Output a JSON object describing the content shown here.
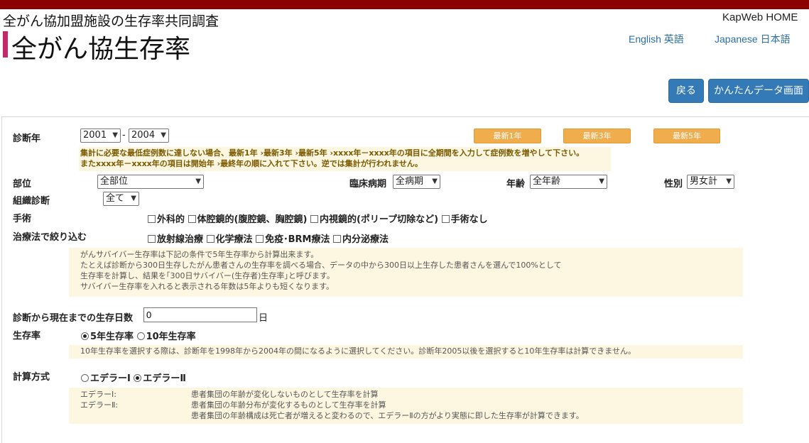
{
  "header": {
    "subtitle": "全がん協加盟施設の生存率共同調査",
    "title": "全がん協生存率",
    "kapweb_link": "KapWeb HOME",
    "lang_en": "English 英語",
    "lang_ja": "Japanese 日本語"
  },
  "toolbar": {
    "back_label": "戻る",
    "simple_label": "かんたんデータ画面"
  },
  "form": {
    "diag_year": {
      "label": "診断年",
      "from": "2001",
      "to": "2004",
      "separator": "-",
      "recent_buttons": [
        "最新1年",
        "最新3年",
        "最新5年"
      ],
      "warning_lines": [
        "集計に必要な最低症例数に達しない場合、最新1年 ›最新3年 ›最新5年 ›xxxx年－xxxx年の項目に全期間を入力して症例数を増やして下さい。",
        "またxxxx年－xxxx年の項目は開始年 ›最終年の順に入れて下さい。逆では集計が行われません。"
      ]
    },
    "site": {
      "label": "部位",
      "value": "全部位"
    },
    "stage": {
      "label": "臨床病期",
      "value": "全病期"
    },
    "age": {
      "label": "年齢",
      "value": "全年齢"
    },
    "sex": {
      "label": "性別",
      "value": "男女計"
    },
    "histology": {
      "label": "組織診断",
      "value": "全て"
    },
    "surgery": {
      "label": "手術",
      "options": [
        "外科的",
        "体腔鏡的(腹腔鏡、胸腔鏡)",
        "内視鏡的(ポリープ切除など)",
        "手術なし"
      ]
    },
    "therapy": {
      "label": "治療法で絞り込む",
      "options": [
        "放射線治療",
        "化学療法",
        "免疫･BRM療法",
        "内分泌療法"
      ]
    },
    "survivor_note": [
      "がんサバイバー生存率は下記の条件で5年生存率から計算出来ます。",
      "たとえば診断から300日生存したがん患者さんの生存率を調べる場合、データの中から300日以上生存した患者さんを選んで100%として",
      "生存率を計算し、結果を｢300日サバイバー(生存者)生存率｣と呼びます。",
      "サバイバー生存率を入れると表示される年数は5年よりも短くなります。"
    ],
    "survival_days": {
      "label": "診断から現在までの生存日数",
      "value": "0",
      "unit": "日"
    },
    "rate": {
      "label": "生存率",
      "option5": "5年生存率",
      "option10": "10年生存率",
      "selected": "5年生存率",
      "note": "10年生存率を選択する際は、診断年を1998年から2004年の間になるように選択してください。診断年2005以後を選択すると10年生存率は計算できません。"
    },
    "method": {
      "label": "計算方式",
      "option1": "エデラーⅠ",
      "option2": "エデラーⅡ",
      "selected": "エデラーⅡ",
      "notes": [
        {
          "term": "エデラーⅠ:",
          "desc": "患者集団の年齢が変化しないものとして生存率を計算"
        },
        {
          "term": "エデラーⅡ:",
          "desc": "患者集団の年齢分布が変化するものとして生存率を計算"
        },
        {
          "term": "",
          "desc": "患者集団の年齢構成は死亡者が増えると変わるので、エデラーⅡの方がより実態に即した生存率が計算できます。"
        }
      ]
    }
  },
  "colors": {
    "top_bar": "#8b0000",
    "brand_bar": "#c4286b",
    "primary_button": "#337ab7",
    "recent_button": "#f0ad4e",
    "note_background": "#fdf6e0",
    "link": "#2a6fa8"
  }
}
